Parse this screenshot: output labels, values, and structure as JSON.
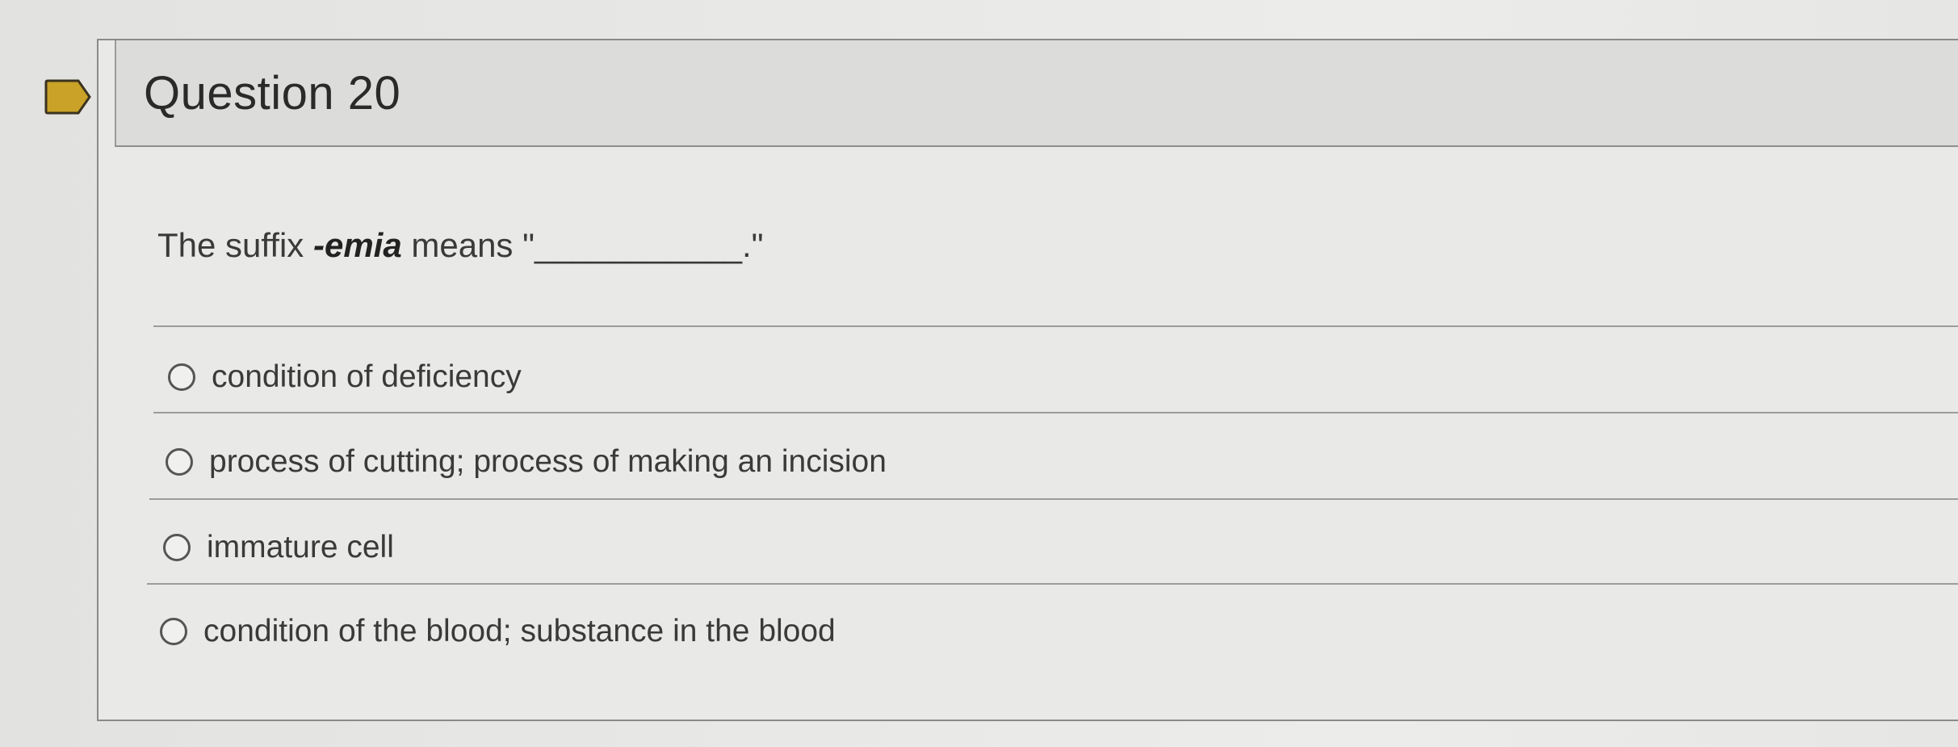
{
  "question": {
    "title": "Question 20",
    "text_prefix": "The suffix ",
    "text_term": "-emia",
    "text_suffix": " means \"___________.\""
  },
  "options": [
    {
      "label": "condition of deficiency",
      "selected": false
    },
    {
      "label": "process of cutting; process of making an incision",
      "selected": false
    },
    {
      "label": "immature cell",
      "selected": false
    },
    {
      "label": "condition of the blood; substance in the blood",
      "selected": false
    }
  ],
  "colors": {
    "flag": "#c9a227",
    "background": "#e6e6e4",
    "header": "#dcdcda",
    "text": "#3a3a3a"
  },
  "icons": {
    "flag": "flag-icon",
    "radio": "radio-unchecked-icon"
  }
}
